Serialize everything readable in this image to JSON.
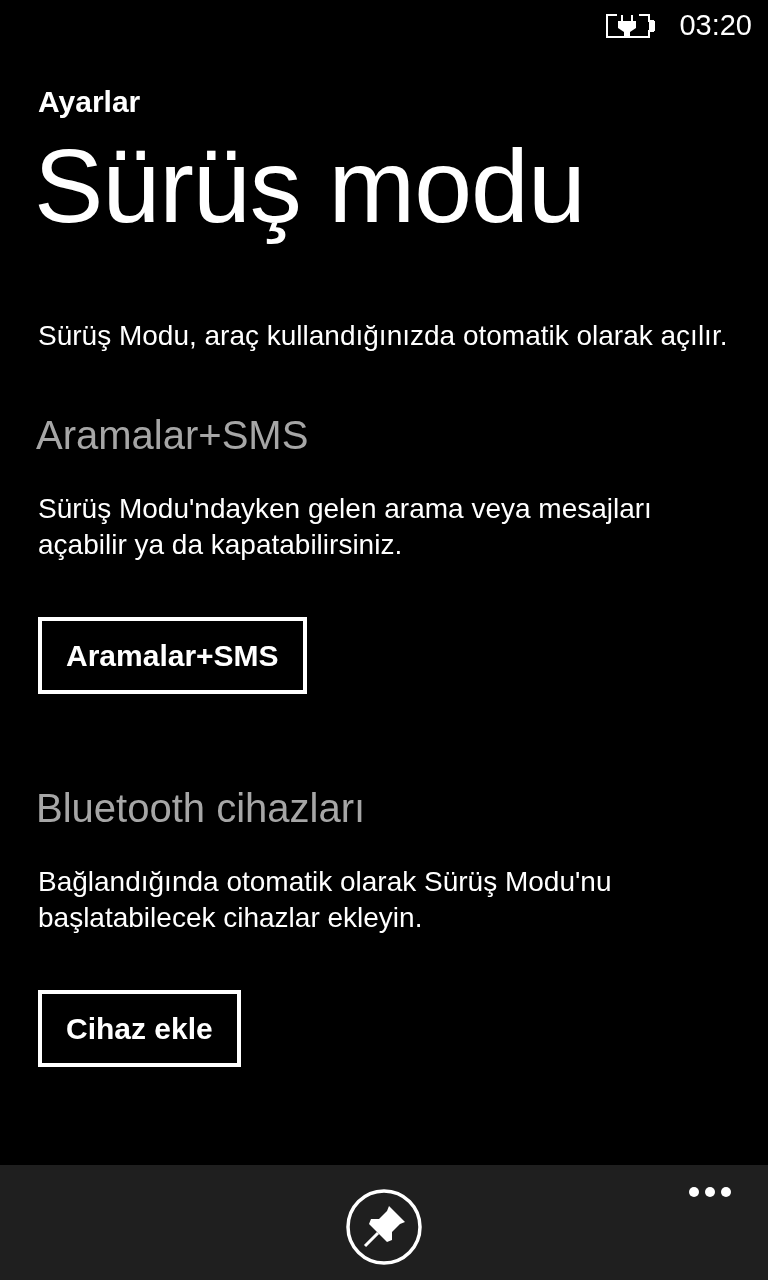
{
  "status_bar": {
    "time": "03:20"
  },
  "app_name": "Ayarlar",
  "title": "Sürüş modu",
  "description": "Sürüş Modu, araç kullandığınızda otomatik olarak açılır.",
  "sections": [
    {
      "header": "Aramalar+SMS",
      "description": "Sürüş Modu'ndayken gelen arama veya mesajları açabilir ya da kapatabilirsiniz.",
      "button": "Aramalar+SMS"
    },
    {
      "header": "Bluetooth cihazları",
      "description": "Bağlandığında otomatik olarak Sürüş Modu'nu başlatabilecek cihazlar ekleyin.",
      "button": "Cihaz ekle"
    }
  ]
}
